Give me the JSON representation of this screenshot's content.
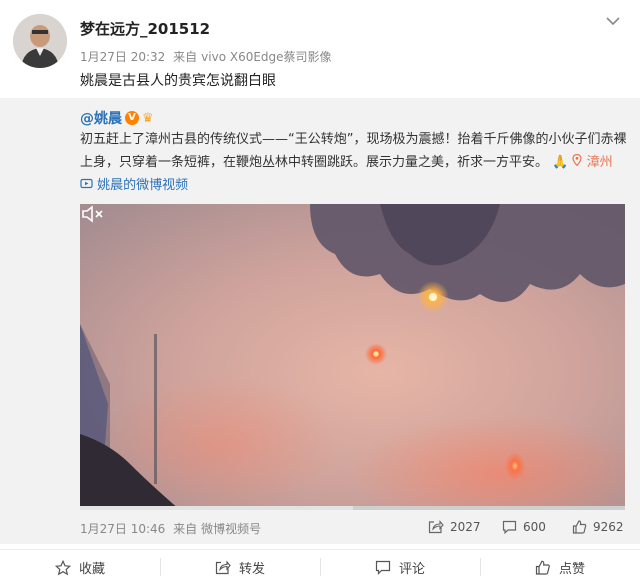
{
  "post": {
    "username": "梦在远方_201512",
    "time": "1月27日 20:32",
    "source_prefix": "来自",
    "source": "vivo X60Edge蔡司影像",
    "text": "姚晨是古县人的贵宾怎说翻白眼"
  },
  "repost": {
    "author": "@姚晨",
    "text_main": "初五赶上了漳州古县的传统仪式——“王公转炮”，现场极为震撼！抬着千斤佛像的小伙子们赤裸上身，只穿着一条短裤，在鞭炮丛林中转圈跳跃。展示力量之美，祈求一方平安。",
    "pray_emoji": "🙏",
    "location": "漳州",
    "video_link": "姚晨的微博视频",
    "time": "1月27日 10:46",
    "source_prefix": "来自",
    "source": "微博视频号",
    "repost_count": "2027",
    "comment_count": "600",
    "like_count": "9262",
    "video_progress_fraction": 0.5
  },
  "actions": {
    "favorite": "收藏",
    "repost": "转发",
    "comment": "评论",
    "like": "点赞"
  }
}
